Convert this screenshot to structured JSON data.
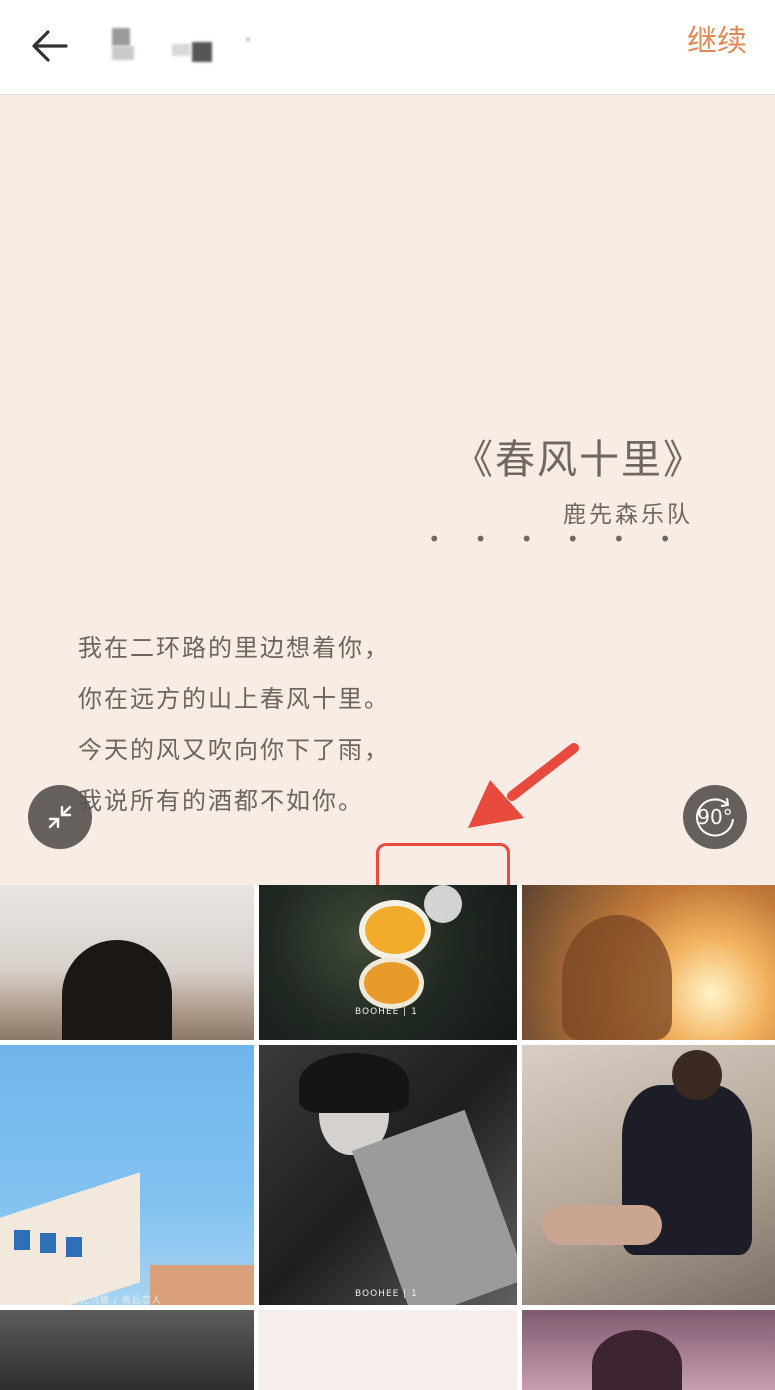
{
  "header": {
    "continue_label": "继续",
    "title_blurred": true
  },
  "preview": {
    "song_title": "《春风十里》",
    "artist": "鹿先森乐队",
    "dots": "• • • • • •",
    "lyrics": [
      "我在二环路的里边想着你，",
      "你在远方的山上春风十里。",
      "今天的风又吹向你下了雨，",
      "我说所有的酒都不如你。"
    ],
    "rotate_label": "90°"
  },
  "colors": {
    "accent": "#e08a55",
    "preview_bg": "#f8ece4",
    "highlight": "#e84a3d"
  },
  "templates": {
    "tiles": [
      {
        "name": "template-sunset-silhouette"
      },
      {
        "name": "template-egg-food",
        "caption": "BOOHEE | 1"
      },
      {
        "name": "template-golden-sunlight"
      },
      {
        "name": "template-blue-sky-building",
        "caption": "日光沉稳 / 雨后恋人"
      },
      {
        "name": "template-bw-portrait",
        "caption": "BOOHEE | 1"
      },
      {
        "name": "template-woman-black-dress"
      },
      {
        "name": "template-dark-street"
      },
      {
        "name": "template-plain-pink"
      },
      {
        "name": "template-purple-portrait"
      }
    ]
  }
}
